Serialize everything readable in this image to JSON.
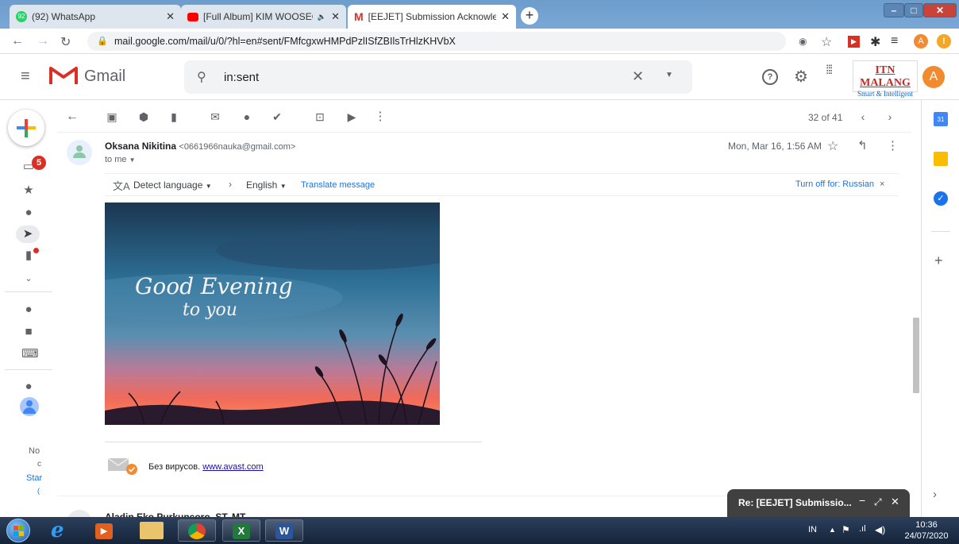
{
  "browser": {
    "tabs": [
      {
        "label": "(92) WhatsApp",
        "badge": "92",
        "icon": "whatsapp-icon",
        "color": "#25d366"
      },
      {
        "label": "[Full Album] KIM WOOSEOK",
        "icon": "youtube-icon",
        "color": "#ff0000"
      },
      {
        "label": "[EEJET] Submission Acknowledge",
        "icon": "gmail-icon",
        "color": "#d93025"
      }
    ],
    "url": "mail.google.com/mail/u/0/?hl=en#sent/FMfcgxwHMPdPzlISfZBIlsTrHlzKHVbX",
    "profile_letter": "A"
  },
  "gmail": {
    "logo_text": "Gmail",
    "search_value": "in:sent",
    "org_name": "ITN MALANG",
    "org_tagline": "Smart & Intelligent",
    "avatar_letter": "A",
    "compose_badge": "5"
  },
  "toolbar": {
    "pagination": "32 of 41"
  },
  "message": {
    "sender_name": "Oksana Nikitina",
    "sender_email": "<0661966nauka@gmail.com>",
    "to_line": "to me",
    "date": "Mon, Mar 16, 1:56 AM",
    "detect_language": "Detect language",
    "target_language": "English",
    "translate_link": "Translate message",
    "turn_off": "Turn off for: Russian",
    "image_line1": "Good Evening",
    "image_line2": "to you",
    "avast_text": "Без вирусов.",
    "avast_link": "www.avast.com",
    "next_sender": "Aladin Eko Purkuncoro, ST, MT"
  },
  "sidebar_partial": {
    "line1": "No",
    "line2": "c",
    "line3": "Star"
  },
  "popup": {
    "title": "Re: [EEJET] Submissio..."
  },
  "taskbar": {
    "lang": "IN",
    "time": "10:36",
    "date": "24/07/2020"
  },
  "colors": {
    "gmail_red": "#d93025",
    "link_blue": "#1a73e8",
    "popup_bg": "#404040",
    "taskbar": "#1b2c45"
  }
}
